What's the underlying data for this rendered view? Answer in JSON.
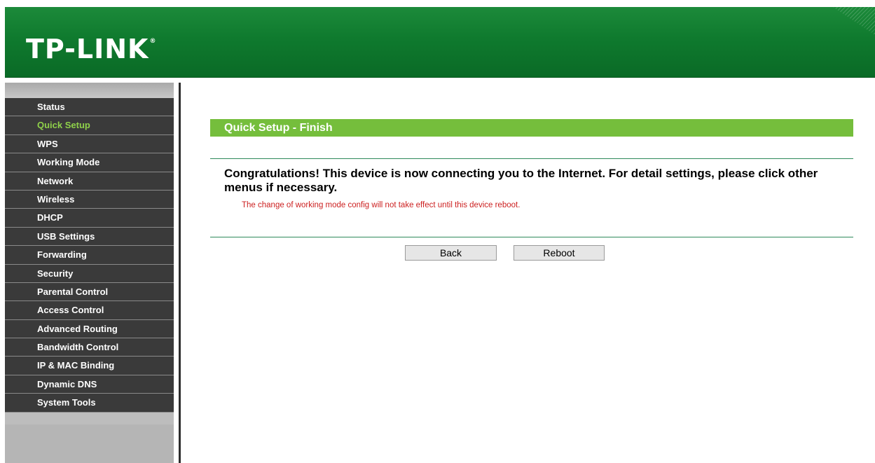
{
  "header": {
    "logo_text": "TP-LINK",
    "logo_mark": "®"
  },
  "sidebar": {
    "active_color": "#8fd14a",
    "items": [
      {
        "label": "Status"
      },
      {
        "label": "Quick Setup",
        "active": true
      },
      {
        "label": "WPS"
      },
      {
        "label": "Working Mode"
      },
      {
        "label": "Network"
      },
      {
        "label": "Wireless"
      },
      {
        "label": "DHCP"
      },
      {
        "label": "USB Settings"
      },
      {
        "label": "Forwarding"
      },
      {
        "label": "Security"
      },
      {
        "label": "Parental Control"
      },
      {
        "label": "Access Control"
      },
      {
        "label": "Advanced Routing"
      },
      {
        "label": "Bandwidth Control"
      },
      {
        "label": "IP & MAC Binding"
      },
      {
        "label": "Dynamic DNS"
      },
      {
        "label": "System Tools"
      }
    ]
  },
  "main": {
    "title": "Quick Setup - Finish",
    "message": "Congratulations! This device is now connecting you to the Internet. For detail settings, please click other menus if necessary.",
    "warning": "The change of working mode config will not take effect until this device reboot.",
    "back_label": "Back",
    "reboot_label": "Reboot"
  },
  "colors": {
    "header_green": "#0f7a2e",
    "title_bar_green": "#75be3c",
    "warning_red": "#cc1f1f",
    "menu_bg": "#3a3a3a"
  }
}
